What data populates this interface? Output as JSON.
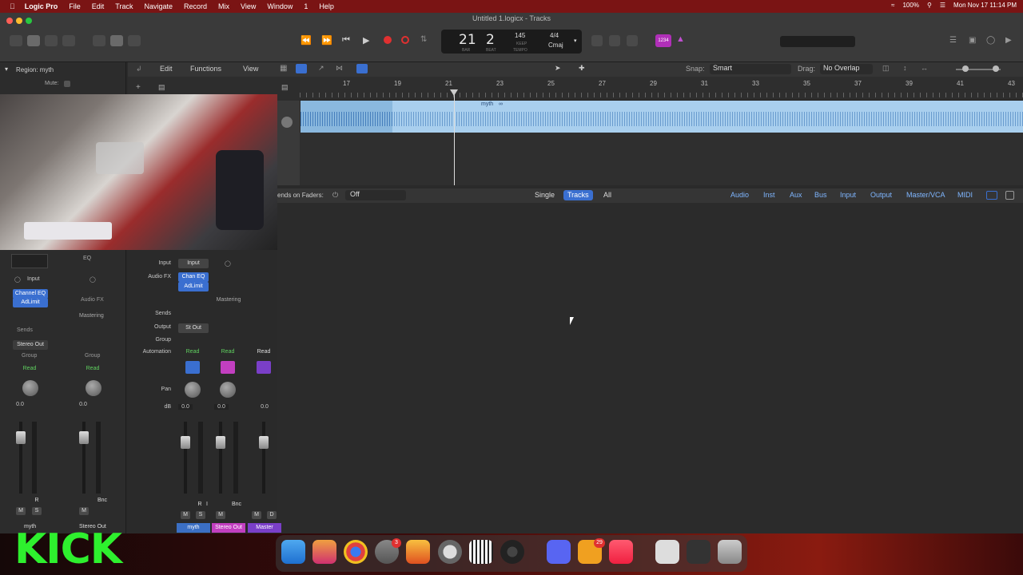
{
  "menubar": {
    "app": "Logic Pro",
    "items": [
      "File",
      "Edit",
      "Track",
      "Navigate",
      "Record",
      "Mix",
      "View",
      "Window",
      "1",
      "Help"
    ],
    "battery": "100%",
    "datetime": "Mon Nov 17  11:14 PM"
  },
  "window": {
    "title": "Untitled 1.logicx - Tracks"
  },
  "lcd": {
    "bar": "21",
    "beat": "2",
    "bar_label": "BAR",
    "beat_label": "BEAT",
    "tempo": "145",
    "tempo_sub": "KEEP",
    "tempo_label": "TEMPO",
    "signature": "4/4",
    "key": "Cmaj"
  },
  "toolbar": {
    "count_in": "1234"
  },
  "inspector": {
    "region_label": "Region: myth",
    "mute_label": "Mute:"
  },
  "tracks_controls": {
    "edit": "Edit",
    "functions": "Functions",
    "view": "View",
    "snap_label": "Snap:",
    "snap_value": "Smart",
    "drag_label": "Drag:",
    "drag_value": "No Overlap"
  },
  "ruler": {
    "bars": [
      "17",
      "19",
      "21",
      "23",
      "25",
      "27",
      "29",
      "31",
      "33",
      "35",
      "37",
      "39",
      "41",
      "43"
    ]
  },
  "region": {
    "name": "myth"
  },
  "mixer": {
    "sends_label": "ends on Faders:",
    "sends_value": "Off",
    "view_buttons": [
      "Single",
      "Tracks",
      "All"
    ],
    "filters": [
      "Audio",
      "Inst",
      "Aux",
      "Bus",
      "Input",
      "Output",
      "Master/VCA",
      "MIDI"
    ],
    "row_labels": {
      "input": "Input",
      "audio_fx": "Audio FX",
      "sends": "Sends",
      "output": "Output",
      "group": "Group",
      "automation": "Automation",
      "pan": "Pan",
      "db": "dB"
    },
    "strips": [
      {
        "name": "myth",
        "input": "Input",
        "fx1": "Chan EQ",
        "fx2": "AdLimit",
        "output": "St Out",
        "automation": "Read",
        "db": "0.0",
        "color": "#3b6fc4"
      },
      {
        "name": "Stereo Out",
        "fx1": "Mastering",
        "automation": "Read",
        "db": "0.0",
        "color": "#c23fc0"
      },
      {
        "name": "Master",
        "automation": "Read",
        "db": "0.0",
        "color": "#7a3fc8"
      }
    ],
    "buttons": {
      "m": "M",
      "s": "S",
      "d": "D",
      "r": "R",
      "i": "I",
      "bnc": "Bnc"
    }
  },
  "inspector_strips": [
    {
      "name": "myth",
      "input": "Input",
      "fx1": "Channel EQ",
      "fx2": "AdLimit",
      "sends": "Sends",
      "output": "Stereo Out",
      "group": "Group",
      "automation": "Read",
      "db": "0.0"
    },
    {
      "name": "Stereo Out",
      "eq": "EQ",
      "fx": "Audio FX",
      "fx1": "Mastering",
      "group": "Group",
      "automation": "Read",
      "db": "0.0"
    }
  ],
  "overlay": {
    "kick": "KICK"
  },
  "dock": {
    "badges": {
      "settings": "3",
      "discord_pets": "29"
    }
  }
}
